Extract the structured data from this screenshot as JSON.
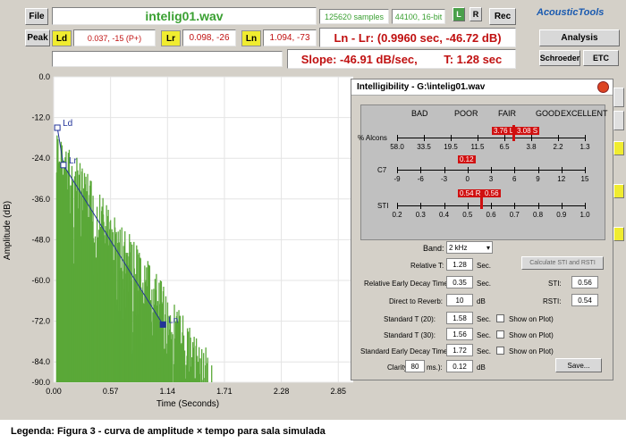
{
  "toolbar": {
    "file_label": "File",
    "filename": "intelig01.wav",
    "samples": "125620 samples",
    "format": "44100, 16-bit",
    "l_label": "L",
    "r_label": "R",
    "rec_label": "Rec",
    "brand": "AcousticTools",
    "peak_label": "Peak",
    "ld_label": "Ld",
    "ld_value": "0.037, -15 (P+)",
    "lr_label": "Lr",
    "lr_value": "0.098, -26",
    "ln_label": "Ln",
    "ln_value": "1.094, -73",
    "ln_lr": "Ln - Lr: (0.9960 sec, -46.72 dB)",
    "slope": "Slope: -46.91 dB/sec,",
    "t_value": "T: 1.28 sec",
    "analysis_label": "Analysis",
    "schroeder_label": "Schroeder",
    "etc_label": "ETC"
  },
  "chart_data": {
    "type": "area",
    "xlabel": "Time (Seconds)",
    "ylabel": "Amplitude (dB)",
    "xlim": [
      0,
      3.0
    ],
    "ylim": [
      -90,
      0
    ],
    "x_ticks": [
      "0.00",
      "0.57",
      "1.14",
      "1.71",
      "2.28",
      "2.85"
    ],
    "x_tick_values": [
      0.0,
      0.57,
      1.14,
      1.71,
      2.28,
      2.85
    ],
    "y_ticks": [
      "0.0",
      "-12.0",
      "-24.0",
      "-36.0",
      "-48.0",
      "-60.0",
      "-72.0",
      "-84.0",
      "-90.0"
    ],
    "y_tick_values": [
      0,
      -12,
      -24,
      -36,
      -48,
      -60,
      -72,
      -84,
      -90
    ],
    "markers": [
      {
        "name": "Ld",
        "x": 0.037,
        "y": -15
      },
      {
        "name": "Lr",
        "x": 0.098,
        "y": -26
      },
      {
        "name": "Ln",
        "x": 1.094,
        "y": -73
      }
    ],
    "decay_end": 1.6,
    "series_color": "#5aa838"
  },
  "dialog": {
    "title": "Intelligibility - G:\\intelig01.wav",
    "categories": [
      "BAD",
      "POOR",
      "FAIR",
      "GOOD",
      "EXCELLENT"
    ],
    "alcons_label": "% Alcons",
    "alcons_ticks": [
      "58.0",
      "33.5",
      "19.5",
      "11.5",
      "6.5",
      "3.8",
      "2.2",
      "1.3"
    ],
    "alcons_left": "3.76 L",
    "alcons_right": "3.08 S",
    "c7_label": "C7",
    "c7_ticks": [
      "-9",
      "-6",
      "-3",
      "0",
      "3",
      "6",
      "9",
      "12",
      "15"
    ],
    "c7_value": "0.12",
    "sti_label": "STI",
    "sti_ticks": [
      "0.2",
      "0.3",
      "0.4",
      "0.5",
      "0.6",
      "0.7",
      "0.8",
      "0.9",
      "1.0"
    ],
    "sti_left": "0.54 R",
    "sti_right": "0.56",
    "band_label": "Band:",
    "band_value": "2 kHz",
    "relative_t_label": "Relative T:",
    "relative_t_value": "1.28",
    "redt_label": "Relative Early Decay Time:",
    "redt_value": "0.35",
    "d2r_label": "Direct to Reverb:",
    "d2r_value": "10",
    "t20_label": "Standard T (20):",
    "t20_value": "1.58",
    "t30_label": "Standard T (30):",
    "t30_value": "1.56",
    "sedt_label": "Standard Early Decay Time:",
    "sedt_value": "1.72",
    "clarity_label": "Clarity (",
    "clarity_ms": "80",
    "clarity_ms_unit": "ms.):",
    "clarity_value": "0.12",
    "sec_unit": "Sec.",
    "db_unit": "dB",
    "show_on_plot": "Show on Plot)",
    "calc_button": "Calculate STI and RSTI",
    "sti_field_label": "STI:",
    "sti_field_value": "0.56",
    "rsti_field_label": "RSTI:",
    "rsti_field_value": "0.54",
    "save_button": "Save..."
  },
  "caption": "Legenda: Figura 3 - curva de amplitude × tempo para sala simulada"
}
